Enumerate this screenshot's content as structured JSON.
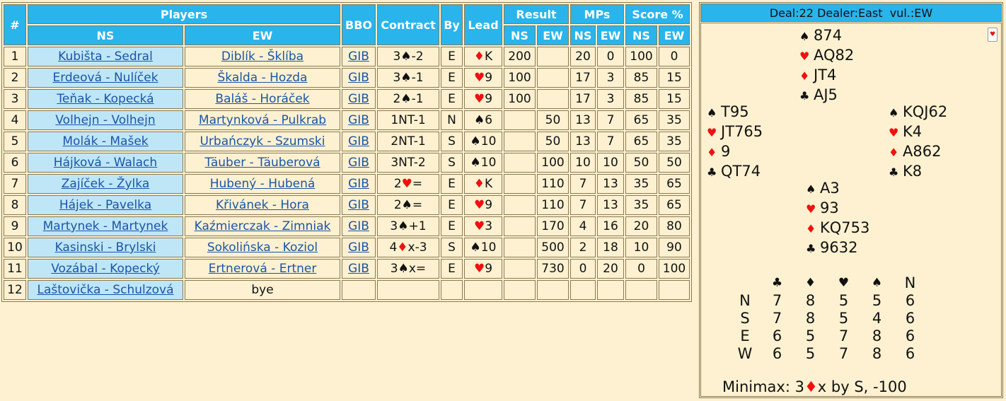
{
  "header": {
    "num": "#",
    "players": "Players",
    "ns": "NS",
    "ew": "EW",
    "bbo": "BBO",
    "contract": "Contract",
    "by": "By",
    "lead": "Lead",
    "result": "Result",
    "mps": "MPs",
    "score": "Score %",
    "sub_ns": "NS",
    "sub_ew": "EW"
  },
  "rows": [
    {
      "n": "1",
      "ns": "Kubišta - Sedral",
      "ew": "Diblík - Šklíba",
      "bbo": "GIB",
      "contract": "3♠-2",
      "by": "E",
      "lead": "♦K",
      "res_ns": "200",
      "res_ew": "",
      "mp_ns": "20",
      "mp_ew": "0",
      "sc_ns": "100",
      "sc_ew": "0"
    },
    {
      "n": "2",
      "ns": "Erdeová - Nulíček",
      "ew": "Škalda - Hozda",
      "bbo": "GIB",
      "contract": "3♠-1",
      "by": "E",
      "lead": "♥9",
      "res_ns": "100",
      "res_ew": "",
      "mp_ns": "17",
      "mp_ew": "3",
      "sc_ns": "85",
      "sc_ew": "15"
    },
    {
      "n": "3",
      "ns": "Teňak - Kopecká",
      "ew": "Baláš - Horáček",
      "bbo": "GIB",
      "contract": "2♠-1",
      "by": "E",
      "lead": "♥9",
      "res_ns": "100",
      "res_ew": "",
      "mp_ns": "17",
      "mp_ew": "3",
      "sc_ns": "85",
      "sc_ew": "15"
    },
    {
      "n": "4",
      "ns": "Volhejn - Volhejn",
      "ew": "Martynková - Pulkrab",
      "bbo": "GIB",
      "contract": "1NT-1",
      "by": "N",
      "lead": "♠6",
      "res_ns": "",
      "res_ew": "50",
      "mp_ns": "13",
      "mp_ew": "7",
      "sc_ns": "65",
      "sc_ew": "35"
    },
    {
      "n": "5",
      "ns": "Molák - Mašek",
      "ew": "Urbańczyk - Szumski",
      "bbo": "GIB",
      "contract": "2NT-1",
      "by": "S",
      "lead": "♠10",
      "res_ns": "",
      "res_ew": "50",
      "mp_ns": "13",
      "mp_ew": "7",
      "sc_ns": "65",
      "sc_ew": "35"
    },
    {
      "n": "6",
      "ns": "Hájková - Walach",
      "ew": "Täuber - Täuberová",
      "bbo": "GIB",
      "contract": "3NT-2",
      "by": "S",
      "lead": "♠10",
      "res_ns": "",
      "res_ew": "100",
      "mp_ns": "10",
      "mp_ew": "10",
      "sc_ns": "50",
      "sc_ew": "50"
    },
    {
      "n": "7",
      "ns": "Zajíček - Žylka",
      "ew": "Hubený - Hubená",
      "bbo": "GIB",
      "contract": "2♥=",
      "by": "E",
      "lead": "♦K",
      "res_ns": "",
      "res_ew": "110",
      "mp_ns": "7",
      "mp_ew": "13",
      "sc_ns": "35",
      "sc_ew": "65"
    },
    {
      "n": "8",
      "ns": "Hájek - Pavelka",
      "ew": "Křivánek - Hora",
      "bbo": "GIB",
      "contract": "2♠=",
      "by": "E",
      "lead": "♥9",
      "res_ns": "",
      "res_ew": "110",
      "mp_ns": "7",
      "mp_ew": "13",
      "sc_ns": "35",
      "sc_ew": "65"
    },
    {
      "n": "9",
      "ns": "Martynek - Martynek",
      "ew": "Kaźmierczak - Zimniak",
      "bbo": "GIB",
      "contract": "3♠+1",
      "by": "E",
      "lead": "♥3",
      "res_ns": "",
      "res_ew": "170",
      "mp_ns": "4",
      "mp_ew": "16",
      "sc_ns": "20",
      "sc_ew": "80"
    },
    {
      "n": "10",
      "ns": "Kasinski - Brylski",
      "ew": "Sokolińska - Koziol",
      "bbo": "GIB",
      "contract": "4♦x-3",
      "by": "S",
      "lead": "♠10",
      "res_ns": "",
      "res_ew": "500",
      "mp_ns": "2",
      "mp_ew": "18",
      "sc_ns": "10",
      "sc_ew": "90"
    },
    {
      "n": "11",
      "ns": "Vozábal - Kopecký",
      "ew": "Ertnerová - Ertner",
      "bbo": "GIB",
      "contract": "3♠x=",
      "by": "E",
      "lead": "♥9",
      "res_ns": "",
      "res_ew": "730",
      "mp_ns": "0",
      "mp_ew": "20",
      "sc_ns": "0",
      "sc_ew": "100"
    },
    {
      "n": "12",
      "ns": "Laštovička - Schulzová",
      "ew": "bye",
      "bye": true
    }
  ],
  "deal": {
    "header": "Deal:22 Dealer:East  vul.:EW",
    "card_icon": "card-icon",
    "north": {
      "spades": "874",
      "hearts": "AQ82",
      "diamonds": "JT4",
      "clubs": "AJ5"
    },
    "west": {
      "spades": "T95",
      "hearts": "JT765",
      "diamonds": "9",
      "clubs": "QT74"
    },
    "east": {
      "spades": "KQJ62",
      "hearts": "K4",
      "diamonds": "A862",
      "clubs": "K8"
    },
    "south": {
      "spades": "A3",
      "hearts": "93",
      "diamonds": "KQ753",
      "clubs": "9632"
    },
    "suits": {
      "spade": "♠",
      "heart": "♥",
      "diamond": "♦",
      "club": "♣"
    },
    "dd": {
      "header": [
        "♣",
        "♦",
        "♥",
        "♠",
        "N"
      ],
      "rows": [
        {
          "seat": "N",
          "vals": [
            "7",
            "8",
            "5",
            "5",
            "6"
          ]
        },
        {
          "seat": "S",
          "vals": [
            "7",
            "8",
            "5",
            "4",
            "6"
          ]
        },
        {
          "seat": "E",
          "vals": [
            "6",
            "5",
            "7",
            "8",
            "6"
          ]
        },
        {
          "seat": "W",
          "vals": [
            "6",
            "5",
            "7",
            "8",
            "6"
          ]
        }
      ]
    },
    "minimax": {
      "prefix": "Minimax: 3",
      "suit": "♦",
      "suffix": "x by S, -100"
    }
  },
  "colors": {
    "header_bg": "#29b4ec",
    "ns_bg": "#bfe6f7",
    "page_bg": "#fdf1d1",
    "red_suit": "#ee1111",
    "link": "#1a55a8"
  }
}
